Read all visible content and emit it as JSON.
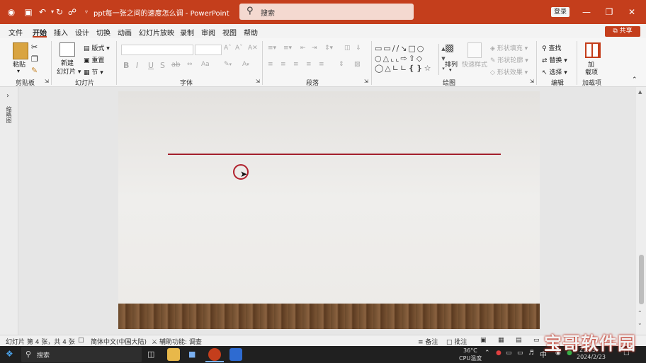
{
  "titlebar": {
    "doc_title": "ppt每一张之间的速度怎么调",
    "app_name": "PowerPoint",
    "title_separator": " - ",
    "search_placeholder": "搜索",
    "login": "登录"
  },
  "menu": {
    "tabs": [
      "文件",
      "开始",
      "插入",
      "设计",
      "切换",
      "动画",
      "幻灯片放映",
      "录制",
      "审阅",
      "视图",
      "帮助"
    ],
    "active_tab": "开始",
    "share": "共享"
  },
  "ribbon": {
    "clipboard": {
      "paste": "粘贴",
      "label": "剪贴板"
    },
    "slides": {
      "new_slide_line1": "新建",
      "new_slide_line2": "幻灯片",
      "layout": "版式",
      "reset": "重置",
      "section": "节",
      "label": "幻灯片"
    },
    "font": {
      "label": "字体",
      "format_buttons": [
        "B",
        "I",
        "U",
        "S",
        "ab"
      ]
    },
    "paragraph": {
      "label": "段落"
    },
    "drawing": {
      "arrange": "排列",
      "quick_styles": "快速样式",
      "shape_fill": "形状填充",
      "shape_outline": "形状轮廓",
      "shape_effects": "形状效果",
      "label": "绘图"
    },
    "editing": {
      "find": "查找",
      "replace": "替换",
      "select": "选择",
      "label": "编辑"
    },
    "addins": {
      "line1": "加",
      "line2": "载项",
      "label": "加载项"
    }
  },
  "left_panel": {
    "label": "缩略图"
  },
  "status": {
    "slide_info": "幻灯片 第 4 张，共 4 张",
    "language": "简体中文(中国大陆)",
    "accessibility": "辅助功能: 调查",
    "notes": "备注",
    "comments": "批注"
  },
  "taskbar": {
    "search": "搜索",
    "temp": "36°C",
    "cpu": "CPU温度",
    "ime": "中",
    "time": "21:55",
    "date": "2024/2/23"
  },
  "watermark": "宝哥软件园",
  "colors": {
    "accent": "#c43e1c",
    "line": "#a31f2c"
  }
}
